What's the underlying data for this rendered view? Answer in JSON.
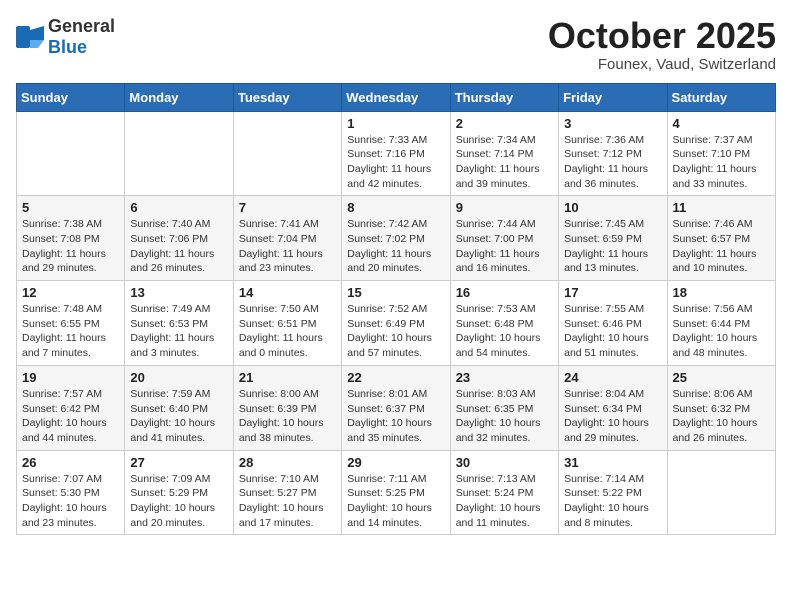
{
  "logo": {
    "general": "General",
    "blue": "Blue"
  },
  "header": {
    "month": "October 2025",
    "location": "Founex, Vaud, Switzerland"
  },
  "weekdays": [
    "Sunday",
    "Monday",
    "Tuesday",
    "Wednesday",
    "Thursday",
    "Friday",
    "Saturday"
  ],
  "weeks": [
    [
      {
        "day": "",
        "sunrise": "",
        "sunset": "",
        "daylight": ""
      },
      {
        "day": "",
        "sunrise": "",
        "sunset": "",
        "daylight": ""
      },
      {
        "day": "",
        "sunrise": "",
        "sunset": "",
        "daylight": ""
      },
      {
        "day": "1",
        "sunrise": "Sunrise: 7:33 AM",
        "sunset": "Sunset: 7:16 PM",
        "daylight": "Daylight: 11 hours and 42 minutes."
      },
      {
        "day": "2",
        "sunrise": "Sunrise: 7:34 AM",
        "sunset": "Sunset: 7:14 PM",
        "daylight": "Daylight: 11 hours and 39 minutes."
      },
      {
        "day": "3",
        "sunrise": "Sunrise: 7:36 AM",
        "sunset": "Sunset: 7:12 PM",
        "daylight": "Daylight: 11 hours and 36 minutes."
      },
      {
        "day": "4",
        "sunrise": "Sunrise: 7:37 AM",
        "sunset": "Sunset: 7:10 PM",
        "daylight": "Daylight: 11 hours and 33 minutes."
      }
    ],
    [
      {
        "day": "5",
        "sunrise": "Sunrise: 7:38 AM",
        "sunset": "Sunset: 7:08 PM",
        "daylight": "Daylight: 11 hours and 29 minutes."
      },
      {
        "day": "6",
        "sunrise": "Sunrise: 7:40 AM",
        "sunset": "Sunset: 7:06 PM",
        "daylight": "Daylight: 11 hours and 26 minutes."
      },
      {
        "day": "7",
        "sunrise": "Sunrise: 7:41 AM",
        "sunset": "Sunset: 7:04 PM",
        "daylight": "Daylight: 11 hours and 23 minutes."
      },
      {
        "day": "8",
        "sunrise": "Sunrise: 7:42 AM",
        "sunset": "Sunset: 7:02 PM",
        "daylight": "Daylight: 11 hours and 20 minutes."
      },
      {
        "day": "9",
        "sunrise": "Sunrise: 7:44 AM",
        "sunset": "Sunset: 7:00 PM",
        "daylight": "Daylight: 11 hours and 16 minutes."
      },
      {
        "day": "10",
        "sunrise": "Sunrise: 7:45 AM",
        "sunset": "Sunset: 6:59 PM",
        "daylight": "Daylight: 11 hours and 13 minutes."
      },
      {
        "day": "11",
        "sunrise": "Sunrise: 7:46 AM",
        "sunset": "Sunset: 6:57 PM",
        "daylight": "Daylight: 11 hours and 10 minutes."
      }
    ],
    [
      {
        "day": "12",
        "sunrise": "Sunrise: 7:48 AM",
        "sunset": "Sunset: 6:55 PM",
        "daylight": "Daylight: 11 hours and 7 minutes."
      },
      {
        "day": "13",
        "sunrise": "Sunrise: 7:49 AM",
        "sunset": "Sunset: 6:53 PM",
        "daylight": "Daylight: 11 hours and 3 minutes."
      },
      {
        "day": "14",
        "sunrise": "Sunrise: 7:50 AM",
        "sunset": "Sunset: 6:51 PM",
        "daylight": "Daylight: 11 hours and 0 minutes."
      },
      {
        "day": "15",
        "sunrise": "Sunrise: 7:52 AM",
        "sunset": "Sunset: 6:49 PM",
        "daylight": "Daylight: 10 hours and 57 minutes."
      },
      {
        "day": "16",
        "sunrise": "Sunrise: 7:53 AM",
        "sunset": "Sunset: 6:48 PM",
        "daylight": "Daylight: 10 hours and 54 minutes."
      },
      {
        "day": "17",
        "sunrise": "Sunrise: 7:55 AM",
        "sunset": "Sunset: 6:46 PM",
        "daylight": "Daylight: 10 hours and 51 minutes."
      },
      {
        "day": "18",
        "sunrise": "Sunrise: 7:56 AM",
        "sunset": "Sunset: 6:44 PM",
        "daylight": "Daylight: 10 hours and 48 minutes."
      }
    ],
    [
      {
        "day": "19",
        "sunrise": "Sunrise: 7:57 AM",
        "sunset": "Sunset: 6:42 PM",
        "daylight": "Daylight: 10 hours and 44 minutes."
      },
      {
        "day": "20",
        "sunrise": "Sunrise: 7:59 AM",
        "sunset": "Sunset: 6:40 PM",
        "daylight": "Daylight: 10 hours and 41 minutes."
      },
      {
        "day": "21",
        "sunrise": "Sunrise: 8:00 AM",
        "sunset": "Sunset: 6:39 PM",
        "daylight": "Daylight: 10 hours and 38 minutes."
      },
      {
        "day": "22",
        "sunrise": "Sunrise: 8:01 AM",
        "sunset": "Sunset: 6:37 PM",
        "daylight": "Daylight: 10 hours and 35 minutes."
      },
      {
        "day": "23",
        "sunrise": "Sunrise: 8:03 AM",
        "sunset": "Sunset: 6:35 PM",
        "daylight": "Daylight: 10 hours and 32 minutes."
      },
      {
        "day": "24",
        "sunrise": "Sunrise: 8:04 AM",
        "sunset": "Sunset: 6:34 PM",
        "daylight": "Daylight: 10 hours and 29 minutes."
      },
      {
        "day": "25",
        "sunrise": "Sunrise: 8:06 AM",
        "sunset": "Sunset: 6:32 PM",
        "daylight": "Daylight: 10 hours and 26 minutes."
      }
    ],
    [
      {
        "day": "26",
        "sunrise": "Sunrise: 7:07 AM",
        "sunset": "Sunset: 5:30 PM",
        "daylight": "Daylight: 10 hours and 23 minutes."
      },
      {
        "day": "27",
        "sunrise": "Sunrise: 7:09 AM",
        "sunset": "Sunset: 5:29 PM",
        "daylight": "Daylight: 10 hours and 20 minutes."
      },
      {
        "day": "28",
        "sunrise": "Sunrise: 7:10 AM",
        "sunset": "Sunset: 5:27 PM",
        "daylight": "Daylight: 10 hours and 17 minutes."
      },
      {
        "day": "29",
        "sunrise": "Sunrise: 7:11 AM",
        "sunset": "Sunset: 5:25 PM",
        "daylight": "Daylight: 10 hours and 14 minutes."
      },
      {
        "day": "30",
        "sunrise": "Sunrise: 7:13 AM",
        "sunset": "Sunset: 5:24 PM",
        "daylight": "Daylight: 10 hours and 11 minutes."
      },
      {
        "day": "31",
        "sunrise": "Sunrise: 7:14 AM",
        "sunset": "Sunset: 5:22 PM",
        "daylight": "Daylight: 10 hours and 8 minutes."
      },
      {
        "day": "",
        "sunrise": "",
        "sunset": "",
        "daylight": ""
      }
    ]
  ]
}
